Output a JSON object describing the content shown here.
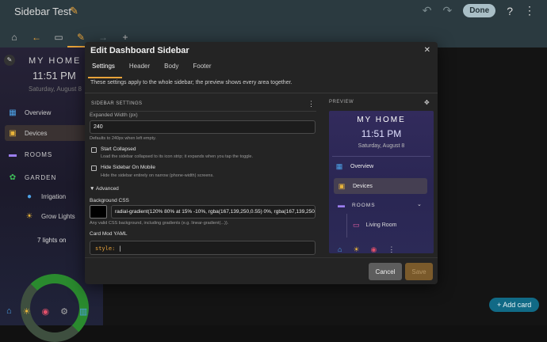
{
  "app": {
    "title": "Sidebar Test",
    "done_label": "Done"
  },
  "left_panel": {
    "title": "MY HOME",
    "time": "11:51 PM",
    "date": "Saturday, August 8",
    "items": [
      {
        "label": "Overview"
      },
      {
        "label": "Devices"
      },
      {
        "label": "ROOMS"
      },
      {
        "label": "GARDEN"
      },
      {
        "label": "Irrigation"
      },
      {
        "label": "Grow Lights"
      }
    ],
    "lights_text": "7 lights on"
  },
  "add_card_label": "Add card",
  "dialog": {
    "title": "Edit Dashboard Sidebar",
    "tabs": [
      "Settings",
      "Header",
      "Body",
      "Footer"
    ],
    "hint": "These settings apply to the whole sidebar; the preview shows every area together.",
    "section_label": "SIDEBAR SETTINGS",
    "expanded_width_label": "Expanded Width (px)",
    "expanded_width_value": "240",
    "expanded_width_helper": "Defaults to 240px when left empty.",
    "start_collapsed_label": "Start Collapsed",
    "start_collapsed_helper": "Load the sidebar collapsed to its icon strip; it expands when you tap the toggle.",
    "hide_mobile_label": "Hide Sidebar On Mobile",
    "hide_mobile_helper": "Hide the sidebar entirely on narrow (phone-width) screens.",
    "advanced_label": "Advanced",
    "background_css_label": "Background CSS",
    "background_css_value": "radial-gradient(120% 80% at 15% -10%, rgba(167,139,250,0.55) 0%, rgba(167,139,250,0)",
    "background_css_helper": "Any valid CSS background, including gradients (e.g. linear-gradient(...)).",
    "card_mod_label": "Card Mod YAML",
    "card_mod_key": "style:",
    "card_mod_value": "|",
    "preview_label": "PREVIEW",
    "preview": {
      "title": "MY HOME",
      "time": "11:51 PM",
      "date": "Saturday, August 8",
      "items": [
        {
          "label": "Overview"
        },
        {
          "label": "Devices"
        }
      ],
      "rooms_label": "ROOMS",
      "room_item": "Living Room"
    },
    "cancel_label": "Cancel",
    "save_label": "Save"
  },
  "colors": {
    "accent": "#e8a33a",
    "primary": "#116a86",
    "preview_bg": "#2f2a5a"
  }
}
